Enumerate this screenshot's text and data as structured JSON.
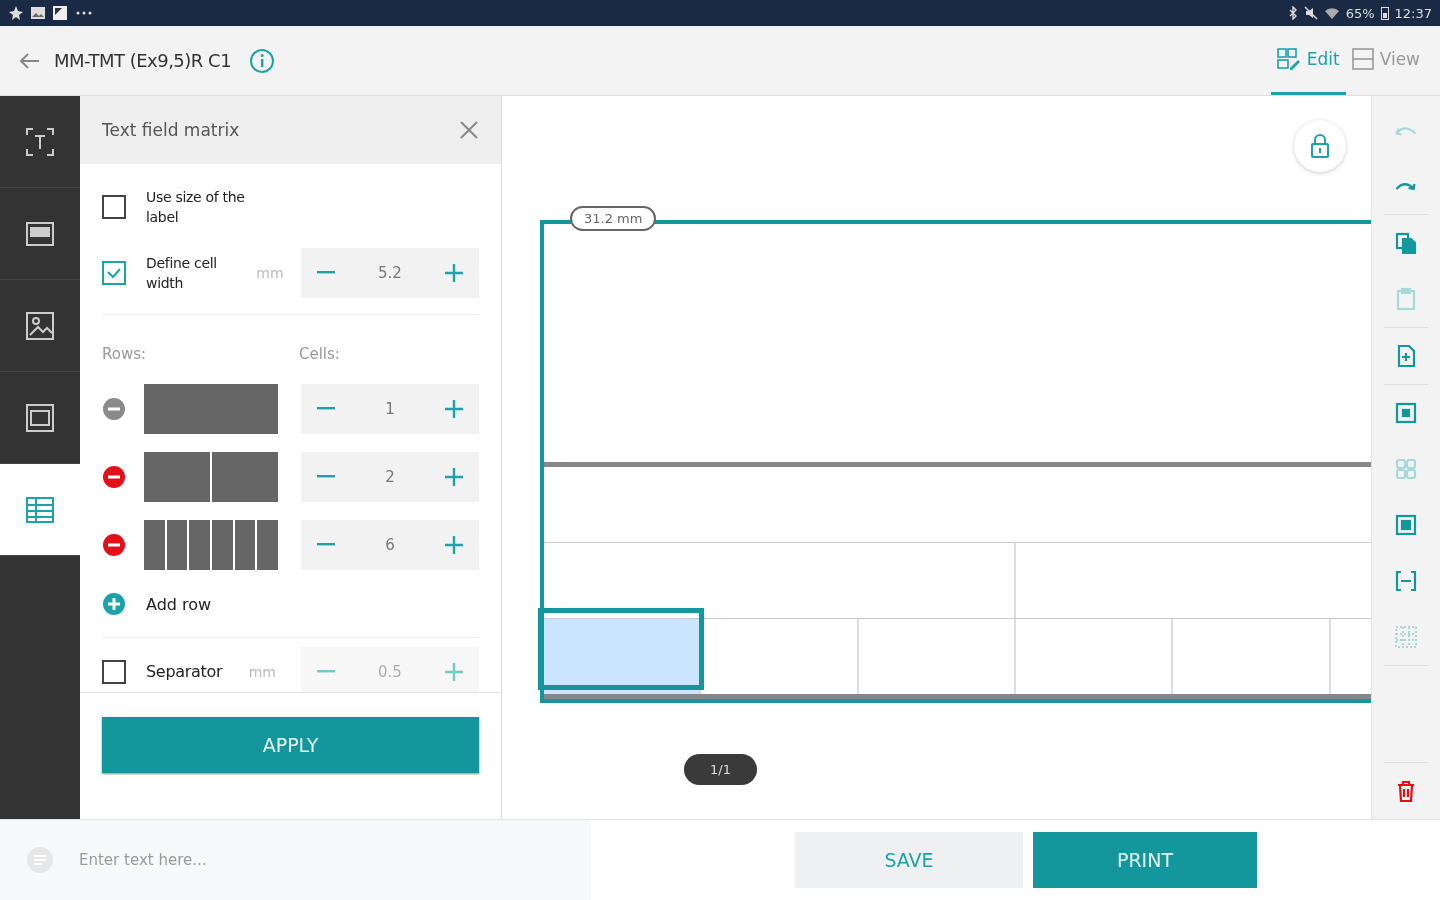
{
  "status_bar": {
    "battery": "65%",
    "time": "12:37"
  },
  "header": {
    "title": "MM-TMT (Ex9,5)R C1",
    "tabs": [
      {
        "label": "Edit",
        "selected": true
      },
      {
        "label": "View",
        "selected": false
      }
    ]
  },
  "tool_rail": [
    {
      "selected": false
    },
    {
      "selected": false
    },
    {
      "selected": false
    },
    {
      "selected": false
    },
    {
      "selected": true
    }
  ],
  "panel": {
    "title": "Text field matrix",
    "options": [
      {
        "kind": "checkbox",
        "label": "Use size of the label",
        "checked": false
      },
      {
        "kind": "stepper",
        "label": "Define cell width",
        "checked": true,
        "unit": "mm",
        "value": "5.2"
      }
    ],
    "rows_label": "Rows:",
    "cells_label": "Cells:",
    "rows": [
      {
        "cells": "1",
        "removable": false
      },
      {
        "cells": "2",
        "removable": true
      },
      {
        "cells": "6",
        "removable": true
      }
    ],
    "add_row": "Add row",
    "separator": {
      "label": "Separator",
      "checked": false,
      "unit": "mm",
      "value": "0.5"
    },
    "apply": "APPLY"
  },
  "canvas": {
    "dimension": "31.2 mm",
    "page": "1/1"
  },
  "right_toolbar": [
    {
      "disabled": true
    },
    {
      "disabled": false
    },
    {
      "disabled": false
    },
    {
      "disabled": true
    },
    {
      "disabled": false
    },
    {
      "disabled": false
    },
    {
      "disabled": true
    },
    {
      "disabled": false
    },
    {
      "disabled": false
    },
    {
      "disabled": true
    },
    {
      "disabled": false
    }
  ],
  "bottom_bar": {
    "placeholder": "Enter text here...",
    "save": "SAVE",
    "print": "PRINT"
  }
}
